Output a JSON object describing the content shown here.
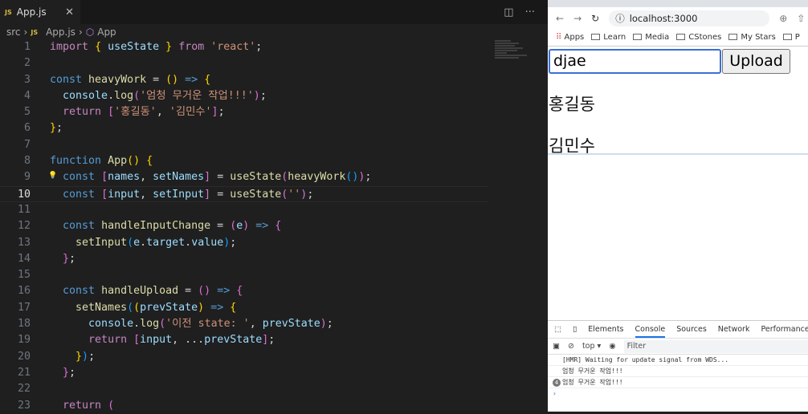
{
  "editor": {
    "tab": {
      "icon": "JS",
      "label": "App.js"
    },
    "breadcrumb": [
      "src",
      "App.js",
      "App"
    ],
    "current_line": 10,
    "lines": [
      [
        [
          "k",
          "import"
        ],
        [
          "p",
          " "
        ],
        [
          "b1",
          "{"
        ],
        [
          "p",
          " "
        ],
        [
          "v",
          "useState"
        ],
        [
          "p",
          " "
        ],
        [
          "b1",
          "}"
        ],
        [
          "p",
          " "
        ],
        [
          "k",
          "from"
        ],
        [
          "p",
          " "
        ],
        [
          "t",
          "'react'"
        ],
        [
          "p",
          ";"
        ]
      ],
      [],
      [
        [
          "s",
          "const"
        ],
        [
          "p",
          " "
        ],
        [
          "f",
          "heavyWork"
        ],
        [
          "p",
          " = "
        ],
        [
          "b1",
          "()"
        ],
        [
          "p",
          " "
        ],
        [
          "s",
          "=>"
        ],
        [
          "p",
          " "
        ],
        [
          "b1",
          "{"
        ]
      ],
      [
        [
          "p",
          "  "
        ],
        [
          "v",
          "console"
        ],
        [
          "p",
          "."
        ],
        [
          "f",
          "log"
        ],
        [
          "b2",
          "("
        ],
        [
          "t",
          "'엄청 무거운 작업!!!'"
        ],
        [
          "b2",
          ")"
        ],
        [
          "p",
          ";"
        ]
      ],
      [
        [
          "p",
          "  "
        ],
        [
          "k",
          "return"
        ],
        [
          "p",
          " "
        ],
        [
          "b2",
          "["
        ],
        [
          "t",
          "'홍길동'"
        ],
        [
          "p",
          ", "
        ],
        [
          "t",
          "'김민수'"
        ],
        [
          "b2",
          "]"
        ],
        [
          "p",
          ";"
        ]
      ],
      [
        [
          "b1",
          "}"
        ],
        [
          "p",
          ";"
        ]
      ],
      [],
      [
        [
          "s",
          "function"
        ],
        [
          "p",
          " "
        ],
        [
          "f",
          "App"
        ],
        [
          "b1",
          "()"
        ],
        [
          "p",
          " "
        ],
        [
          "b1",
          "{"
        ]
      ],
      [
        [
          "p",
          "  "
        ],
        [
          "s",
          "const"
        ],
        [
          "p",
          " "
        ],
        [
          "b2",
          "["
        ],
        [
          "v",
          "names"
        ],
        [
          "p",
          ", "
        ],
        [
          "v",
          "setNames"
        ],
        [
          "b2",
          "]"
        ],
        [
          "p",
          " = "
        ],
        [
          "f",
          "useState"
        ],
        [
          "b2",
          "("
        ],
        [
          "f",
          "heavyWork"
        ],
        [
          "b3",
          "()"
        ],
        [
          "b2",
          ")"
        ],
        [
          "p",
          ";"
        ]
      ],
      [
        [
          "p",
          "  "
        ],
        [
          "s",
          "const"
        ],
        [
          "p",
          " "
        ],
        [
          "b2",
          "["
        ],
        [
          "v",
          "input"
        ],
        [
          "p",
          ", "
        ],
        [
          "v",
          "setInput"
        ],
        [
          "b2",
          "]"
        ],
        [
          "p",
          " = "
        ],
        [
          "f",
          "useState"
        ],
        [
          "b2",
          "("
        ],
        [
          "t",
          "''"
        ],
        [
          "b2",
          ")"
        ],
        [
          "p",
          ";"
        ]
      ],
      [],
      [
        [
          "p",
          "  "
        ],
        [
          "s",
          "const"
        ],
        [
          "p",
          " "
        ],
        [
          "f",
          "handleInputChange"
        ],
        [
          "p",
          " = "
        ],
        [
          "b2",
          "("
        ],
        [
          "v",
          "e"
        ],
        [
          "b2",
          ")"
        ],
        [
          "p",
          " "
        ],
        [
          "s",
          "=>"
        ],
        [
          "p",
          " "
        ],
        [
          "b2",
          "{"
        ]
      ],
      [
        [
          "p",
          "    "
        ],
        [
          "f",
          "setInput"
        ],
        [
          "b3",
          "("
        ],
        [
          "v",
          "e"
        ],
        [
          "p",
          "."
        ],
        [
          "v",
          "target"
        ],
        [
          "p",
          "."
        ],
        [
          "v",
          "value"
        ],
        [
          "b3",
          ")"
        ],
        [
          "p",
          ";"
        ]
      ],
      [
        [
          "p",
          "  "
        ],
        [
          "b2",
          "}"
        ],
        [
          "p",
          ";"
        ]
      ],
      [],
      [
        [
          "p",
          "  "
        ],
        [
          "s",
          "const"
        ],
        [
          "p",
          " "
        ],
        [
          "f",
          "handleUpload"
        ],
        [
          "p",
          " = "
        ],
        [
          "b2",
          "()"
        ],
        [
          "p",
          " "
        ],
        [
          "s",
          "=>"
        ],
        [
          "p",
          " "
        ],
        [
          "b2",
          "{"
        ]
      ],
      [
        [
          "p",
          "    "
        ],
        [
          "f",
          "setNames"
        ],
        [
          "b3",
          "("
        ],
        [
          "b1",
          "("
        ],
        [
          "v",
          "prevState"
        ],
        [
          "b1",
          ")"
        ],
        [
          "p",
          " "
        ],
        [
          "s",
          "=>"
        ],
        [
          "p",
          " "
        ],
        [
          "b1",
          "{"
        ]
      ],
      [
        [
          "p",
          "      "
        ],
        [
          "v",
          "console"
        ],
        [
          "p",
          "."
        ],
        [
          "f",
          "log"
        ],
        [
          "b2",
          "("
        ],
        [
          "t",
          "'이전 state: '"
        ],
        [
          "p",
          ", "
        ],
        [
          "v",
          "prevState"
        ],
        [
          "b2",
          ")"
        ],
        [
          "p",
          ";"
        ]
      ],
      [
        [
          "p",
          "      "
        ],
        [
          "k",
          "return"
        ],
        [
          "p",
          " "
        ],
        [
          "b2",
          "["
        ],
        [
          "v",
          "input"
        ],
        [
          "p",
          ", ..."
        ],
        [
          "v",
          "prevState"
        ],
        [
          "b2",
          "]"
        ],
        [
          "p",
          ";"
        ]
      ],
      [
        [
          "p",
          "    "
        ],
        [
          "b1",
          "}"
        ],
        [
          "b3",
          ")"
        ],
        [
          "p",
          ";"
        ]
      ],
      [
        [
          "p",
          "  "
        ],
        [
          "b2",
          "}"
        ],
        [
          "p",
          ";"
        ]
      ],
      [],
      [
        [
          "p",
          "  "
        ],
        [
          "k",
          "return"
        ],
        [
          "p",
          " "
        ],
        [
          "b2",
          "("
        ]
      ]
    ]
  },
  "browser": {
    "url": "localhost:3000",
    "bookmarks": [
      "Apps",
      "Learn",
      "Media",
      "CStones",
      "My Stars",
      "P"
    ],
    "page": {
      "input_value": "djae",
      "upload_label": "Upload",
      "names": [
        "홍길동",
        "김민수"
      ]
    },
    "devtools": {
      "tabs": [
        "Elements",
        "Console",
        "Sources",
        "Network",
        "Performance"
      ],
      "active_tab": "Console",
      "context": "top ▾",
      "filter_placeholder": "Filter",
      "messages": [
        {
          "text": "[HMR] Waiting for update signal from WDS..."
        },
        {
          "text": "엄청 무거운 작업!!!"
        },
        {
          "text": "엄청 무거운 작업!!!",
          "count": "4"
        }
      ],
      "prompt": "›"
    }
  }
}
